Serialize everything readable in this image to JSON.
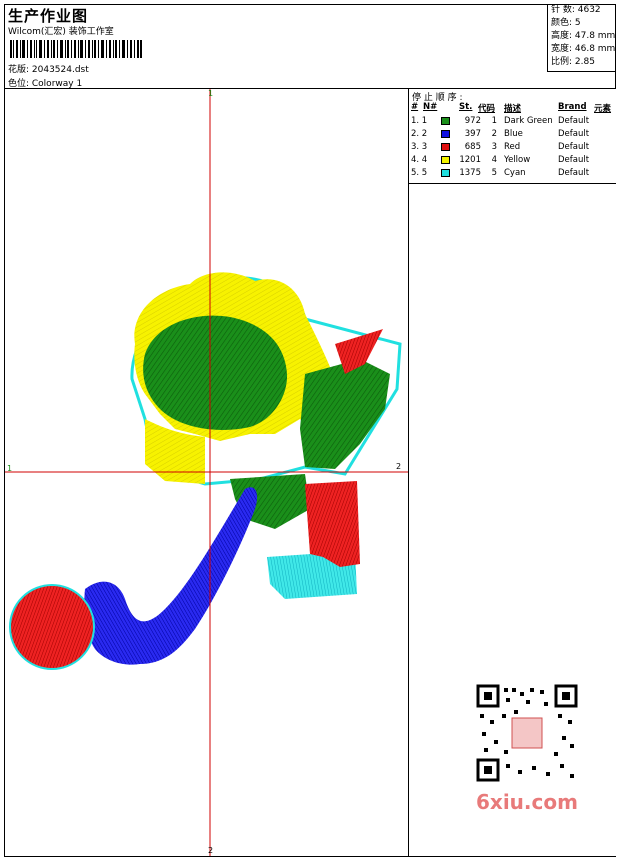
{
  "header": {
    "title": "生产作业图",
    "subtitle": "Wilcom(汇宏) 装饰工作室",
    "design": "花版: 2043524.dst",
    "colorway": "色位: Colorway 1"
  },
  "stats": {
    "stitches": "针 数: 4632",
    "colors": "颜色: 5",
    "height": "高度: 47.8 mm",
    "width": "宽度: 46.8 mm",
    "ratio": "比例: 2.85"
  },
  "stop_table": {
    "title": "停 止 顺 序 :",
    "headers": [
      "#",
      "N#",
      "St.",
      "代码",
      "描述",
      "Brand",
      "元素"
    ],
    "rows": [
      {
        "idx": "1. 1",
        "color": "#1a8f1a",
        "st": "972",
        "code": "1",
        "desc": "Dark Green",
        "brand": "Default"
      },
      {
        "idx": "2. 2",
        "color": "#1010e0",
        "st": "397",
        "code": "2",
        "desc": "Blue",
        "brand": "Default"
      },
      {
        "idx": "3. 3",
        "color": "#e01010",
        "st": "685",
        "code": "3",
        "desc": "Red",
        "brand": "Default"
      },
      {
        "idx": "4. 4",
        "color": "#f5f500",
        "st": "1201",
        "code": "4",
        "desc": "Yellow",
        "brand": "Default"
      },
      {
        "idx": "5. 5",
        "color": "#20e0e0",
        "st": "1375",
        "code": "5",
        "desc": "Cyan",
        "brand": "Default"
      }
    ]
  },
  "axes": {
    "top": "1",
    "bottom": "2",
    "left": "1",
    "right": "2"
  },
  "watermark": "6xiu.com",
  "colors": {
    "axis": "#d00000",
    "green": "#1a8f1a",
    "blue": "#1010e0",
    "red": "#e01010",
    "yellow": "#f5f500",
    "cyan": "#20e0e0"
  }
}
